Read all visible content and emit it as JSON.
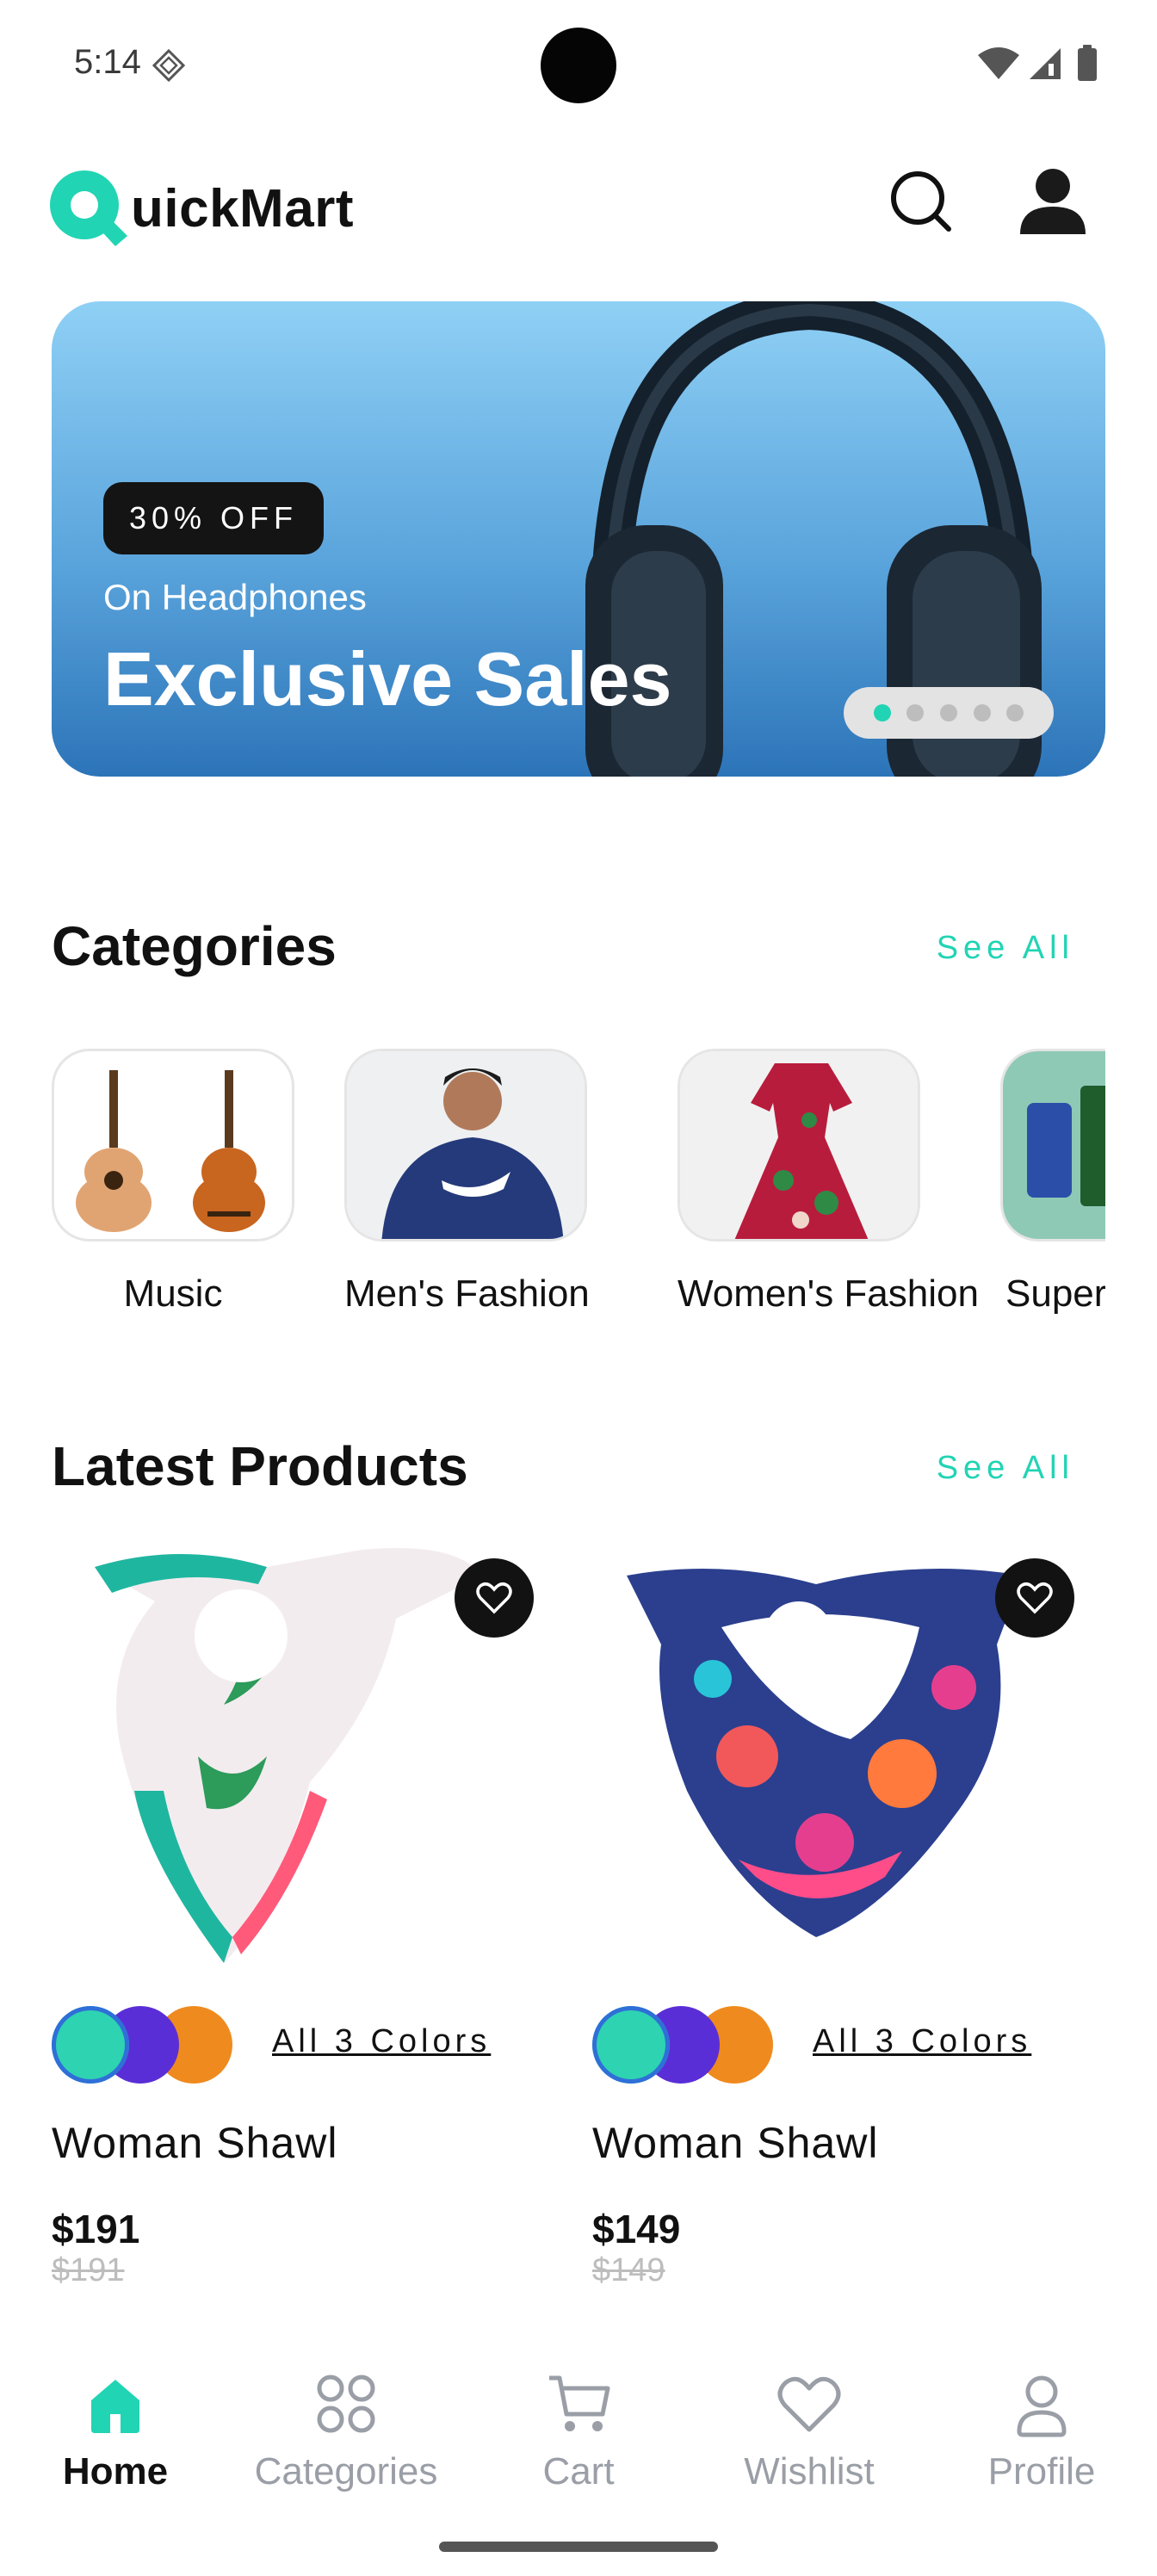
{
  "status_bar": {
    "time": "5:14"
  },
  "app": {
    "logo_letter": "Q",
    "logo_text": "uickMart",
    "accent": "#21d4b4"
  },
  "banner": {
    "badge": "30% OFF",
    "subtitle": "On Headphones",
    "title": "Exclusive Sales",
    "slides": 5,
    "active_slide": 1
  },
  "categories": {
    "title": "Categories",
    "see_all": "See All",
    "items": [
      {
        "label": "Music",
        "icon": "guitar-image"
      },
      {
        "label": "Men's Fashion",
        "icon": "hoodie-man-image"
      },
      {
        "label": "Women's Fashion",
        "icon": "dress-image"
      },
      {
        "label": "Super",
        "icon": "grocery-image"
      }
    ]
  },
  "latest_products": {
    "title": "Latest Products",
    "see_all": "See All",
    "items": [
      {
        "name": "Woman Shawl",
        "price": "$191",
        "old_price": "$191",
        "colors_link": "All 3 Colors",
        "swatches": [
          "#2ed3b1",
          "#5a2ed6",
          "#ef8a1e"
        ]
      },
      {
        "name": "Woman Shawl",
        "price": "$149",
        "old_price": "$149",
        "colors_link": "All 3 Colors",
        "swatches": [
          "#2ed3b1",
          "#5a2ed6",
          "#ef8a1e"
        ]
      }
    ]
  },
  "bottom_nav": {
    "items": [
      {
        "label": "Home",
        "icon": "home-icon",
        "active": true
      },
      {
        "label": "Categories",
        "icon": "grid-icon",
        "active": false
      },
      {
        "label": "Cart",
        "icon": "cart-icon",
        "active": false
      },
      {
        "label": "Wishlist",
        "icon": "heart-icon",
        "active": false
      },
      {
        "label": "Profile",
        "icon": "user-icon",
        "active": false
      }
    ]
  }
}
